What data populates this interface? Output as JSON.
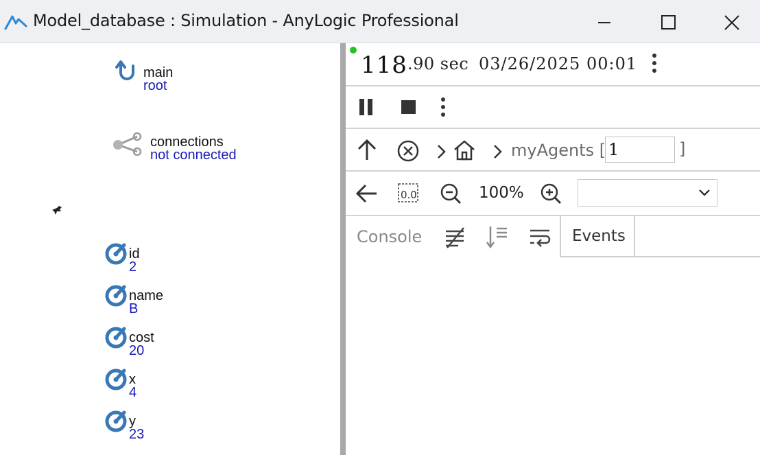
{
  "window": {
    "title": "Model_database : Simulation - AnyLogic Professional",
    "minimize_icon": "minimize-icon",
    "maximize_icon": "maximize-icon",
    "close_icon": "close-icon"
  },
  "left_panel": {
    "root": {
      "name": "main",
      "value": "root"
    },
    "connections": {
      "name": "connections",
      "value": "not connected"
    },
    "params": [
      {
        "name": "id",
        "value": "2"
      },
      {
        "name": "name",
        "value": "B"
      },
      {
        "name": "cost",
        "value": "20"
      },
      {
        "name": "x",
        "value": "4"
      },
      {
        "name": "y",
        "value": "23"
      }
    ]
  },
  "right_panel": {
    "time_int": "118",
    "time_frac": ".90 sec",
    "date": "03/26/2025 00:01",
    "nav": {
      "agents_label": "myAgents [",
      "agent_index": "1",
      "bracket_close": "]"
    },
    "zoom": {
      "value": "100%",
      "selected": ""
    },
    "tabs": {
      "console": "Console",
      "events": "Events"
    }
  },
  "colors": {
    "accent": "#3a78b5",
    "value_text": "#1a1ab8",
    "status_running": "#22c322"
  }
}
